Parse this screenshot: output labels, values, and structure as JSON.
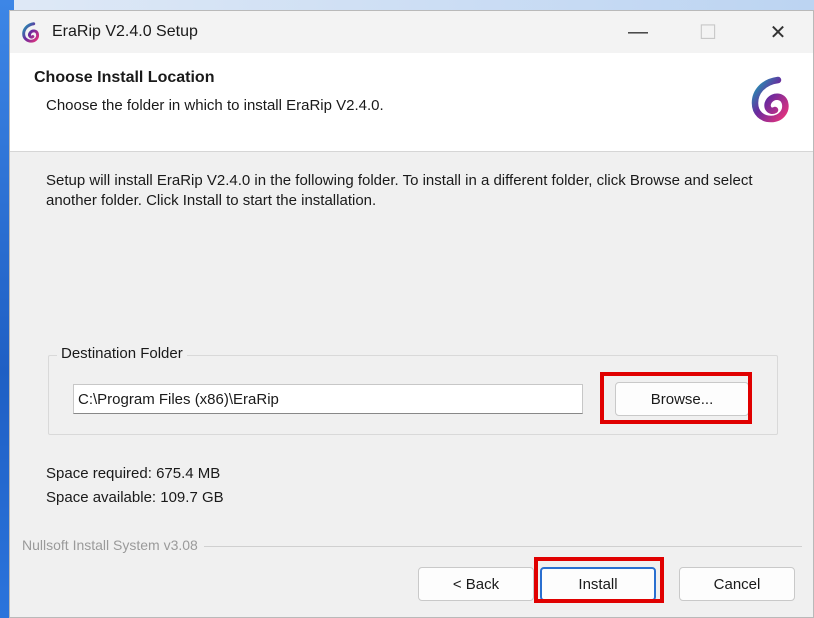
{
  "window": {
    "title": "EraRip V2.4.0 Setup",
    "minimize_glyph": "—",
    "maximize_glyph": "☐",
    "close_glyph": "✕"
  },
  "header": {
    "title": "Choose Install Location",
    "subtitle": "Choose the folder in which to install EraRip V2.4.0."
  },
  "body": {
    "intro": "Setup will install EraRip V2.4.0 in the following folder. To install in a different folder, click Browse and select another folder. Click Install to start the installation."
  },
  "destination": {
    "group_label": "Destination Folder",
    "path": "C:\\Program Files (x86)\\EraRip",
    "browse_label": "Browse..."
  },
  "space": {
    "required": "Space required: 675.4 MB",
    "available": "Space available: 109.7 GB"
  },
  "branding": "Nullsoft Install System v3.08",
  "buttons": {
    "back": "< Back",
    "install": "Install",
    "cancel": "Cancel"
  },
  "colors": {
    "accent": "#2a6fd0",
    "highlight": "#e00000",
    "logo_pink": "#e8327c",
    "logo_teal": "#16a3b6",
    "logo_purple": "#6a2a9e"
  },
  "icons": {
    "app": "erarip-logo-icon"
  }
}
